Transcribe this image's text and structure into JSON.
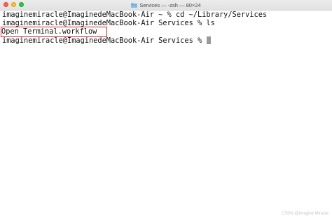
{
  "window": {
    "title": "Services — -zsh — 80×24"
  },
  "terminal": {
    "lines": [
      "imaginemiracle@ImaginedeMacBook-Air ~ % cd ~/Library/Services",
      "imaginemiracle@ImaginedeMacBook-Air Services % ls",
      "Open Terminal.workflow",
      "imaginemiracle@ImaginedeMacBook-Air Services % "
    ]
  },
  "watermark": "CSDN @Imagine Miracle",
  "colors": {
    "highlight_box": "#e0242c",
    "close": "#fe5f57",
    "minimize": "#febc2e",
    "maximize": "#28c840"
  },
  "icons": {
    "title": "folder-icon"
  }
}
